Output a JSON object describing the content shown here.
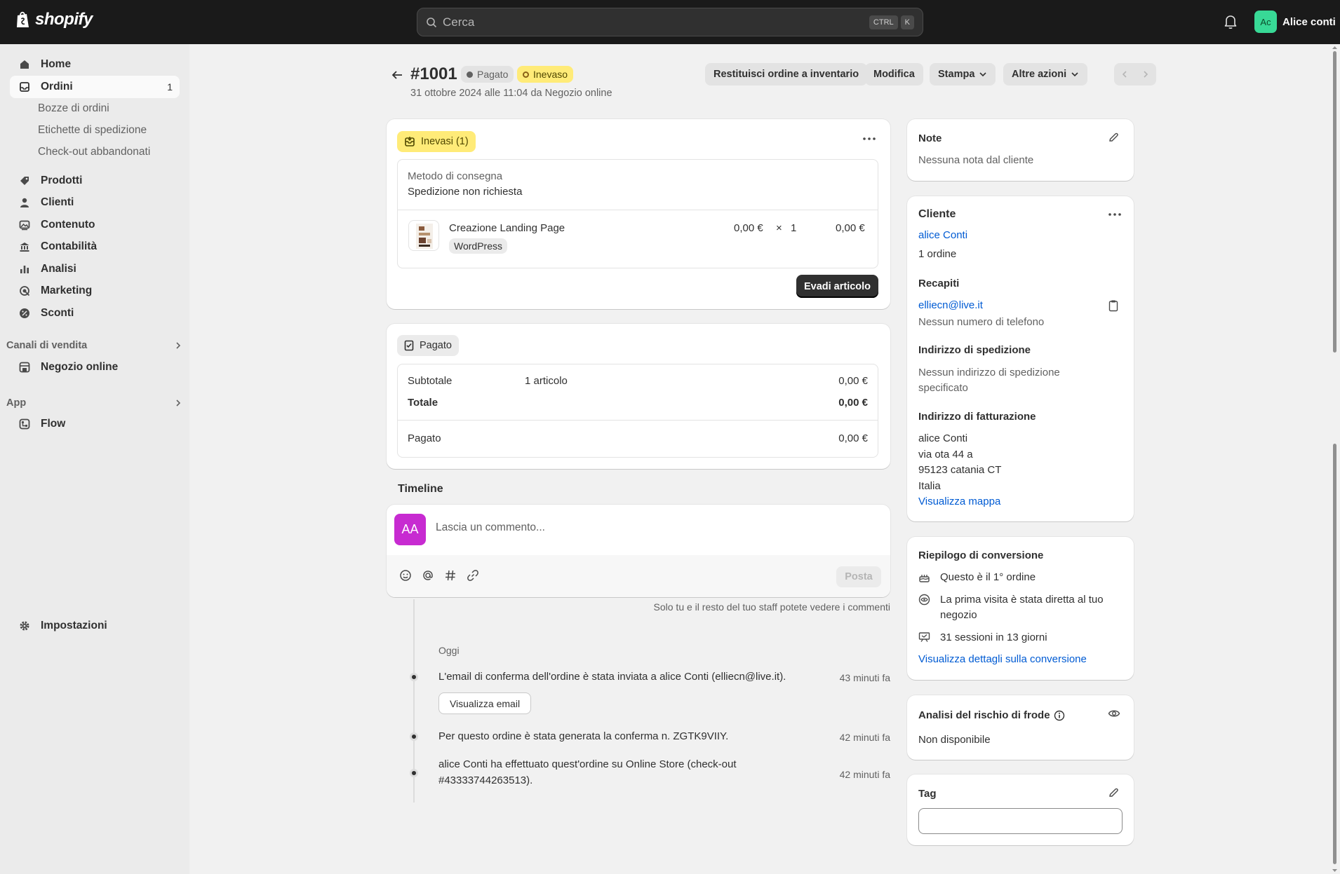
{
  "topbar": {
    "brand": "shopify",
    "search_placeholder": "Cerca",
    "kbd_ctrl": "CTRL",
    "kbd_k": "K",
    "user_initials": "Ac",
    "user_name": "Alice conti"
  },
  "sidebar": {
    "home": "Home",
    "orders": "Ordini",
    "orders_count": "1",
    "sub_drafts": "Bozze di ordini",
    "sub_labels": "Etichette di spedizione",
    "sub_abandoned": "Check-out abbandonati",
    "products": "Prodotti",
    "customers": "Clienti",
    "content": "Contenuto",
    "finance": "Contabilità",
    "analytics": "Analisi",
    "marketing": "Marketing",
    "discounts": "Sconti",
    "sales_channels": "Canali di vendita",
    "online_store": "Negozio online",
    "apps": "App",
    "flow": "Flow",
    "settings": "Impostazioni"
  },
  "header": {
    "order_id": "#1001",
    "badge_paid": "Pagato",
    "badge_unfulfilled": "Inevaso",
    "subtitle": "31 ottobre 2024 alle 11:04 da Negozio online",
    "restock_btn": "Restituisci ordine a inventario",
    "edit_btn": "Modifica",
    "print_btn": "Stampa",
    "more_btn": "Altre azioni"
  },
  "fulfillment": {
    "badge": "Inevasi (1)",
    "delivery_label": "Metodo di consegna",
    "delivery_value": "Spedizione non richiesta",
    "product_name": "Creazione Landing Page",
    "product_variant": "WordPress",
    "unit_price": "0,00 €",
    "times": "×",
    "qty": "1",
    "line_total": "0,00 €",
    "fulfill_btn": "Evadi articolo"
  },
  "payment": {
    "badge": "Pagato",
    "subtotal_label": "Subtotale",
    "subtotal_items": "1 articolo",
    "subtotal_value": "0,00 €",
    "total_label": "Totale",
    "total_value": "0,00 €",
    "paid_label": "Pagato",
    "paid_value": "0,00 €"
  },
  "timeline": {
    "title": "Timeline",
    "avatar_initials": "AA",
    "comment_placeholder": "Lascia un commento...",
    "post_btn": "Posta",
    "staff_note": "Solo tu e il resto del tuo staff potete vedere i commenti",
    "day_label": "Oggi",
    "events": [
      {
        "text": "L'email di conferma dell'ordine è stata inviata a alice Conti (elliecn@live.it).",
        "time": "43 minuti fa",
        "button": "Visualizza email"
      },
      {
        "text": "Per questo ordine è stata generata la conferma n. ZGTK9VIIY.",
        "time": "42 minuti fa"
      },
      {
        "text_line1": "alice Conti ha effettuato quest'ordine su Online Store (check-out",
        "text_line2": "#43333744263513).",
        "time": "42 minuti fa"
      }
    ]
  },
  "notes": {
    "title": "Note",
    "value": "Nessuna nota dal cliente"
  },
  "customer": {
    "title": "Cliente",
    "name": "alice Conti",
    "orders": "1 ordine",
    "contact_title": "Recapiti",
    "email": "elliecn@live.it",
    "phone": "Nessun numero di telefono",
    "shipping_title": "Indirizzo di spedizione",
    "shipping_line1": "Nessun indirizzo di spedizione",
    "shipping_line2": "specificato",
    "billing_title": "Indirizzo di fatturazione",
    "billing_name": "alice Conti",
    "billing_street": "via ota 44 a",
    "billing_city": "95123 catania CT",
    "billing_country": "Italia",
    "map_link": "Visualizza mappa"
  },
  "conversion": {
    "title": "Riepilogo di conversione",
    "first_order": "Questo è il 1° ordine",
    "first_visit_line1": "La prima visita è stata diretta al tuo",
    "first_visit_line2": "negozio",
    "sessions": "31 sessioni in 13 giorni",
    "details_link": "Visualizza dettagli sulla conversione"
  },
  "fraud": {
    "title": "Analisi del rischio di frode",
    "value": "Non disponibile"
  },
  "tags": {
    "title": "Tag"
  },
  "colors": {
    "topbar": "#1a1a1a",
    "accent_link": "#005bd3",
    "unfulfilled_badge": "#ffeb78",
    "avatar_user": "#38d996",
    "avatar_comment": "#c72bd1"
  }
}
